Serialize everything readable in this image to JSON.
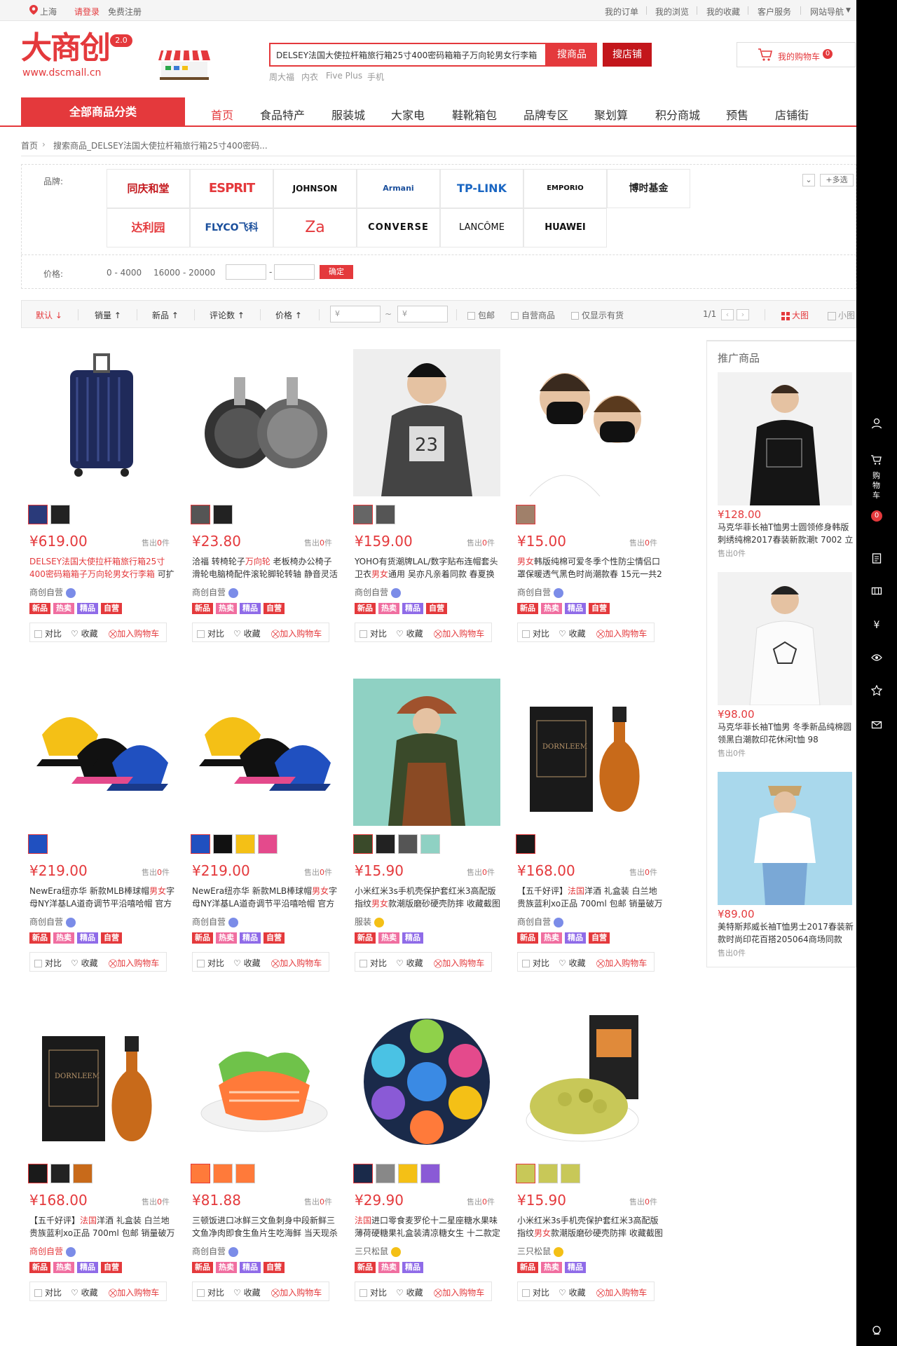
{
  "topbar": {
    "location": "上海",
    "login": "请登录",
    "register": "免费注册",
    "links": [
      "我的订单",
      "我的浏览",
      "我的收藏",
      "客户服务",
      "网站导航"
    ]
  },
  "header": {
    "logo_text": "大商创",
    "logo_badge": "2.0",
    "logo_url": "www.dscmall.cn",
    "search_value": "DELSEY法国大使拉杆箱旅行箱25寸400密码箱箱子万向轮男女行李箱",
    "search_goods": "搜商品",
    "search_shop": "搜店铺",
    "hot_words": [
      "周大福",
      "内衣",
      "Five Plus",
      "手机"
    ],
    "cart_label": "我的购物车",
    "cart_count": "0"
  },
  "nav": {
    "all_categories": "全部商品分类",
    "items": [
      "首页",
      "食品特产",
      "服装城",
      "大家电",
      "鞋靴箱包",
      "品牌专区",
      "聚划算",
      "积分商城",
      "预售",
      "店铺街"
    ]
  },
  "breadcrumb": {
    "home": "首页",
    "current": "搜索商品_DELSEY法国大使拉杆箱旅行箱25寸400密码..."
  },
  "filter": {
    "brand_label": "品牌:",
    "brands": [
      "同庆和堂",
      "ESPRIT",
      "JOHNSON",
      "Armani",
      "TP-LINK",
      "EMPORIO",
      "博时基金",
      "达利园",
      "FLYCO飞科",
      "Za",
      "CONVERSE",
      "LANCÔME",
      "HUAWEI"
    ],
    "multi_select": "+多选",
    "price_label": "价格:",
    "price_ranges": [
      "0 - 4000",
      "16000 - 20000"
    ],
    "price_sep": "-",
    "confirm": "确定"
  },
  "sortbar": {
    "default": "默认",
    "sales": "销量",
    "new": "新品",
    "comments": "评论数",
    "price": "价格",
    "price_min_placeholder": "¥",
    "price_max_placeholder": "¥",
    "tilde": "~",
    "free_shipping": "包邮",
    "self_run": "自营商品",
    "in_stock": "仅显示有货",
    "page": "1/1",
    "big_view": "大图",
    "small_view": "小图"
  },
  "product_common": {
    "sold_prefix": "售出",
    "sold_suffix": "件",
    "compare": "对比",
    "favorite": "收藏",
    "add_cart": "加入购物车",
    "tag_new": "新品",
    "tag_hot": "热卖",
    "tag_fine": "精品",
    "tag_self": "自营"
  },
  "products": [
    {
      "price": "¥619.00",
      "sold": "0",
      "title_hl": "DELSEY法国大使拉杆箱旅行箱25寸400密码箱箱子万向轮男女行李箱",
      "title_rest": " 可扩充容",
      "shop": "商创自营",
      "shop_red": false,
      "thumbs": 2,
      "self": true
    },
    {
      "price": "¥23.80",
      "sold": "0",
      "title_pre": "洽福 转椅轮子",
      "title_hl": "万向轮",
      "title_rest": " 老板椅办公椅子滑轮电脑椅配件滚轮脚轮转轴 静音灵活",
      "shop": "商创自营",
      "shop_red": false,
      "thumbs": 2,
      "self": true
    },
    {
      "price": "¥159.00",
      "sold": "0",
      "title_pre": "YOHO有货潮牌LAL/数字贴布连帽套头卫衣",
      "title_hl": "男女",
      "title_rest": "通用 吴亦凡亲着同款 春夏换",
      "shop": "商创自营",
      "shop_red": false,
      "thumbs": 2,
      "self": true
    },
    {
      "price": "¥15.00",
      "sold": "0",
      "title_pre": "",
      "title_hl": "男女",
      "title_rest": "韩版纯棉可爱冬季个性防尘情侣口罩保暖透气黑色时尚潮款春 15元一共2",
      "shop": "商创自营",
      "shop_red": false,
      "thumbs": 1,
      "self": true
    },
    {
      "price": "¥219.00",
      "sold": "0",
      "title_pre": "NewEra纽亦华 新款MLB棒球帽",
      "title_hl": "男女",
      "title_rest": "字母NY洋基LA道奇调节平沿嘻哈帽 官方",
      "shop": "商创自营",
      "shop_red": false,
      "thumbs": 1,
      "self": true
    },
    {
      "price": "¥219.00",
      "sold": "0",
      "title_pre": "NewEra纽亦华 新款MLB棒球帽",
      "title_hl": "男女",
      "title_rest": "字母NY洋基LA道奇调节平沿嘻哈帽 官方",
      "shop": "商创自营",
      "shop_red": false,
      "thumbs": 4,
      "self": true
    },
    {
      "price": "¥15.90",
      "sold": "0",
      "title_pre": "小米红米3s手机壳保护套红米3高配版指纹",
      "title_hl": "男女",
      "title_rest": "款潮版磨砂硬壳防摔 收藏截图",
      "shop": "服装",
      "shop_red": false,
      "gold": true,
      "thumbs": 4,
      "self": false
    },
    {
      "price": "¥168.00",
      "sold": "0",
      "title_pre": "【五千好评】",
      "title_hl": "法国",
      "title_rest": "洋酒 礼盒装 白兰地 贵族蓝利xo正品 700ml 包邮 销量破万",
      "shop": "商创自营",
      "shop_red": false,
      "thumbs": 1,
      "self": true
    },
    {
      "price": "¥168.00",
      "sold": "0",
      "title_pre": "【五千好评】",
      "title_hl": "法国",
      "title_rest": "洋酒 礼盒装 白兰地 贵族蓝利xo正品 700ml 包邮 销量破万",
      "shop": "商创自营",
      "shop_red": true,
      "thumbs": 3,
      "self": true
    },
    {
      "price": "¥81.88",
      "sold": "0",
      "title_pre": "三顿饭进口冰鲜三文鱼刺身中段新鲜三文鱼净肉即食生鱼片生吃海鲜 当天现杀",
      "title_hl": "",
      "title_rest": "",
      "shop": "商创自营",
      "shop_red": false,
      "thumbs": 3,
      "self": true
    },
    {
      "price": "¥29.90",
      "sold": "0",
      "title_pre": "",
      "title_hl": "法国",
      "title_rest": "进口零食麦罗伦十二星座糖水果味薄荷硬糖果礼盒装清凉糖女生 十二款定",
      "shop": "三只松鼠",
      "shop_red": false,
      "gold": true,
      "thumbs": 4,
      "self": false
    },
    {
      "price": "¥15.90",
      "sold": "0",
      "title_pre": "小米红米3s手机壳保护套红米3高配版指纹",
      "title_hl": "男女",
      "title_rest": "款潮版磨砂硬壳防摔 收藏截图",
      "shop": "三只松鼠",
      "shop_red": false,
      "gold": true,
      "thumbs": 3,
      "self": false
    }
  ],
  "promo": {
    "title": "推广商品",
    "items": [
      {
        "price": "¥128.00",
        "title": "马克华菲长袖T恤男士圆领修身韩版刺绣纯棉2017春装新款潮t 7002 立",
        "sold": "售出0件"
      },
      {
        "price": "¥98.00",
        "title": "马克华菲长袖T恤男 冬季新品纯棉圆领黑白潮款印花休闲t恤 98",
        "sold": "售出0件"
      },
      {
        "price": "¥89.00",
        "title": "美特斯邦威长袖T恤男士2017春装新款时尚印花百搭205064商场同款",
        "sold": "售出0件"
      }
    ]
  },
  "rail": {
    "cart_label": "购物车",
    "cart_count": "0"
  },
  "colors": {
    "accent": "#e4393c",
    "rail": "#000000"
  }
}
